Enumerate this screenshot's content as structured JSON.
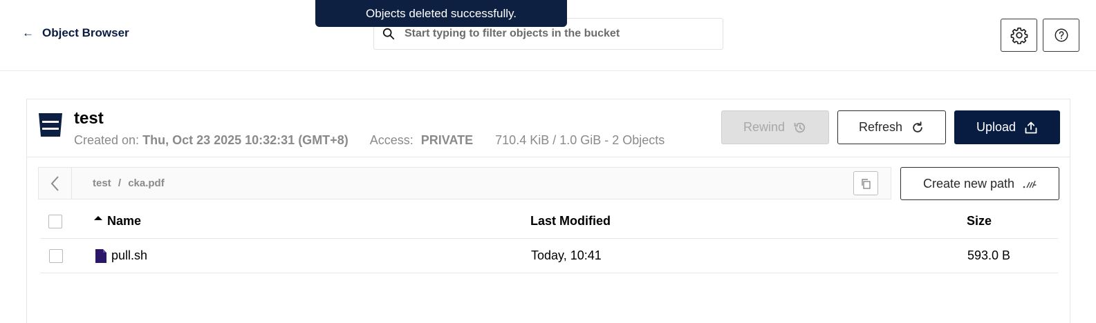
{
  "header": {
    "back_label": "Object Browser",
    "search_placeholder": "Start typing to filter objects in the bucket",
    "toast": "Objects deleted successfully."
  },
  "bucket": {
    "name": "test",
    "created_label": "Created on:",
    "created_value": "Thu, Oct 23 2025 10:32:31 (GMT+8)",
    "access_label": "Access:",
    "access_value": "PRIVATE",
    "usage": "710.4 KiB / 1.0 GiB - 2 Objects"
  },
  "actions": {
    "rewind": "Rewind",
    "refresh": "Refresh",
    "upload": "Upload",
    "create_path": "Create new path"
  },
  "breadcrumb": {
    "bucket": "test",
    "separator": "/",
    "file": "cka.pdf"
  },
  "table": {
    "columns": [
      "Name",
      "Last Modified",
      "Size"
    ],
    "sort_indicator": "ascending",
    "rows": [
      {
        "name": "pull.sh",
        "modified": "Today, 10:41",
        "size": "593.0 B"
      }
    ]
  },
  "colors": {
    "brand_dark": "#081c42",
    "file_icon": "#2b1667"
  }
}
